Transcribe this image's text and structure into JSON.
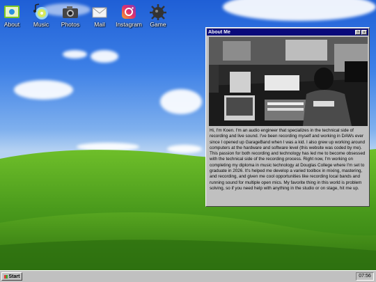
{
  "desktop": {
    "icons": [
      {
        "label": "About",
        "icon": "folder-icon"
      },
      {
        "label": "Music",
        "icon": "music-cd-icon"
      },
      {
        "label": "Photos",
        "icon": "camera-icon"
      },
      {
        "label": "Mail",
        "icon": "envelope-icon"
      },
      {
        "label": "Instagram",
        "icon": "instagram-icon"
      },
      {
        "label": "Game",
        "icon": "game-icon"
      }
    ]
  },
  "window": {
    "title": "About Me",
    "controls": [
      "?",
      "×"
    ],
    "bio": "Hi, I'm Koen. I'm an audio engineer that specializes in the technical side of recording and live sound. I've been recording myself and working in DAWs ever since I opened up GarageBand when I was a kid. I also grew up working around computers at the hardware and software level (this website was coded by me). This passion for both recording and technology has led me to become obsessed with the technical side of the recording process. Right now, I'm working on completing my diploma in music technology at Douglas College where I'm set to graduate in 2026. It's helped me develop a varied toolbox in mixing, mastering, and recording, and given me cool opportunities like recording local bands and running sound for multiple open mics. My favorite thing in this world is problem solving, so if you need help with anything in the studio or on stage, hit me up."
  },
  "taskbar": {
    "start_label": "Start",
    "clock": "07:56"
  }
}
